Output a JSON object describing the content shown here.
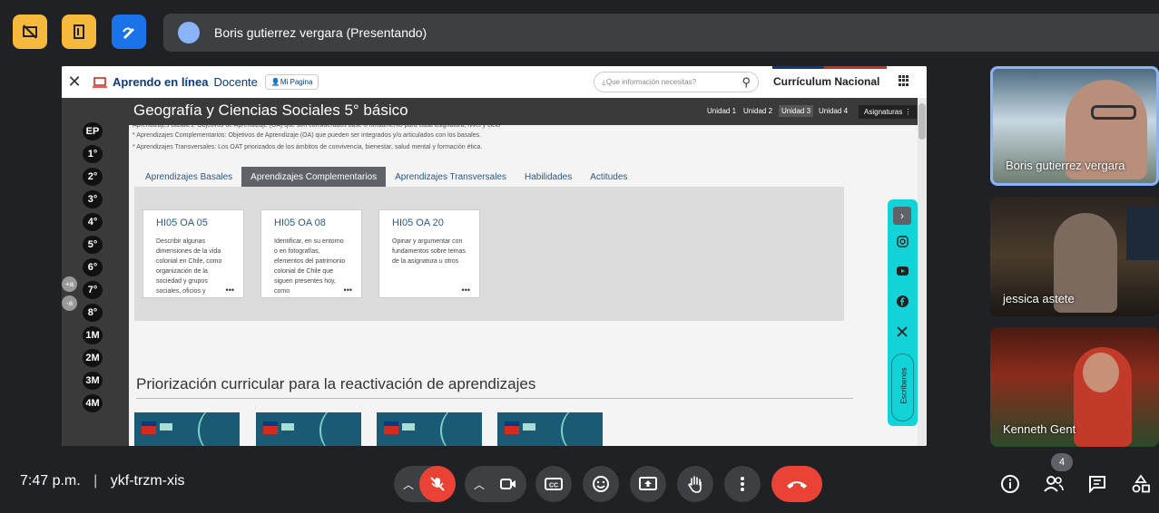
{
  "meet": {
    "presenter_label": "Boris gutierrez vergara (Presentando)",
    "time": "7:47 p.m.",
    "separator": "|",
    "meeting_code": "ykf-trzm-xis",
    "participant_count": "4",
    "accent_red": "#ea4335",
    "tile_border": "#8ab4f8"
  },
  "participants": [
    {
      "name": "Boris gutierrez vergara"
    },
    {
      "name": "jessica astete"
    },
    {
      "name": "Kenneth Gent"
    }
  ],
  "site": {
    "close": "✕",
    "logo": "Aprendo en línea",
    "role": "Docente",
    "my_page": "Mi Pagina",
    "search_placeholder": "¿Que información necesitas?",
    "brand": "Currículum Nacional"
  },
  "grades": [
    "EP",
    "1°",
    "2°",
    "3°",
    "4°",
    "5°",
    "6°",
    "7°",
    "8°",
    "1M",
    "2M",
    "3M",
    "4M"
  ],
  "font_buttons": [
    "+a",
    "-a"
  ],
  "page": {
    "title": "Geografía y Ciencias Sociales 5° básico",
    "units": [
      "Unidad 1",
      "Unidad 2",
      "Unidad 3",
      "Unidad 4"
    ],
    "asignaturas": "Asignaturas",
    "definitions": [
      "Aprendizajes Basales: Objetivos de Aprendizaje (OA) que son considerados base o fundamento para cada asignatura, nivel y ciclo",
      "* Aprendizajes Complementarios: Objetivos de Aprendizaje (OA) que pueden ser integrados y/o articulados con los basales.",
      "* Aprendizajes Transversales: Los OAT priorizados de los ámbitos de convivencia, bienestar, salud mental y formación ética."
    ],
    "tabs": [
      "Aprendizajes Basales",
      "Aprendizajes Complementarios",
      "Aprendizajes Transversales",
      "Habilidades",
      "Actitudes"
    ],
    "active_tab": "Aprendizajes Complementarios",
    "cards": [
      {
        "code": "HI05 OA 05",
        "desc": "Describir algunas dimensiones de la vida colonial en Chile, como organización de la sociedad y grupos sociales, oficios y"
      },
      {
        "code": "HI05 OA 08",
        "desc": "Identificar, en su entorno o en fotografías, elementos del patrimonio colonial de Chile que siguen presentes hoy, como"
      },
      {
        "code": "HI05 OA 20",
        "desc": "Opinar y argumentar con fundamentos sobre temas de la asignatura u otros"
      }
    ],
    "card_more": "•••",
    "priority_title": "Priorización curricular para la reactivación de aprendizajes",
    "write_us": "Escríbenos",
    "social_icons": [
      "instagram-icon",
      "youtube-icon",
      "facebook-icon",
      "x-icon"
    ]
  }
}
